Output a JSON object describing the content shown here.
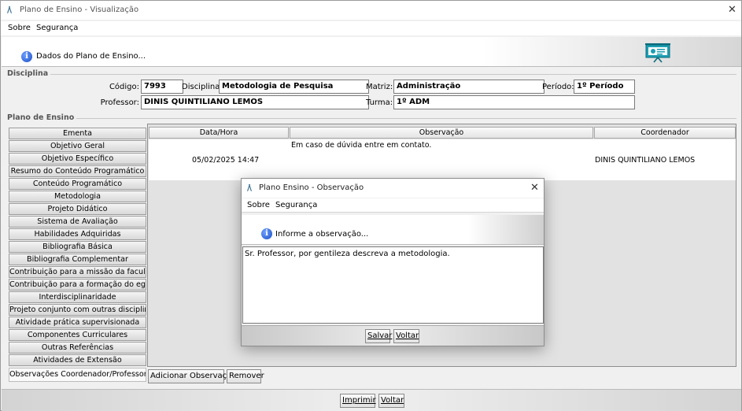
{
  "window": {
    "title": "Plano de Ensino - Visualização",
    "close": "✕",
    "logo": "/\\",
    "menu": [
      "Sobre",
      "Segurança"
    ],
    "banner_text": "Dados do Plano de Ensino...",
    "banner_icon": "info-icon",
    "brand_icon": "presentation-icon"
  },
  "disciplina": {
    "section_label": "Disciplina",
    "codigo_label": "Código:",
    "codigo_value": "7993",
    "disciplina_label": "Disciplina:",
    "disciplina_value": "Metodologia de Pesquisa",
    "matriz_label": "Matriz:",
    "matriz_value": "Administração",
    "periodo_label": "Período:",
    "periodo_value": "1º Período",
    "professor_label": "Professor:",
    "professor_value": "DINIS QUINTILIANO LEMOS",
    "turma_label": "Turma:",
    "turma_value": "1º ADM"
  },
  "plano": {
    "section_label": "Plano de Ensino",
    "items": [
      "Ementa",
      "Objetivo Geral",
      "Objetivo Específico",
      "Resumo do Conteúdo Programático",
      "Conteúdo Programático",
      "Metodologia",
      "Projeto Didático",
      "Sistema de Avaliação",
      "Habilidades Adquiridas",
      "Bibliografia Básica",
      "Bibliografia Complementar",
      "Contribuição para a missão da faculdade",
      "Contribuição para a formação do egresso",
      "Interdisciplinaridade",
      "Projeto conjunto com outras disciplinas",
      "Atividade prática supervisionada",
      "Componentes Curriculares",
      "Outras Referências",
      "Atividades de Extensão",
      "Observações Coordenador/Professor"
    ],
    "active_item": "Observações Coordenador/Professor"
  },
  "table": {
    "columns": [
      "Data/Hora",
      "Observação",
      "Coordenador"
    ],
    "rows": [
      {
        "datahora": "05/02/2025 14:47",
        "observacao": "Em caso de dúvida entre em contato.",
        "coordenador": "DINIS QUINTILIANO LEMOS"
      }
    ]
  },
  "actions": {
    "adicionar": "Adicionar Observação",
    "remover": "Remover",
    "imprimir": "Imprimir",
    "voltar": "Voltar"
  },
  "dialog": {
    "title": "Plano Ensino - Observação",
    "close": "✕",
    "menu": [
      "Sobre",
      "Segurança"
    ],
    "banner_text": "Informe a observação...",
    "text_value": "Sr. Professor, por gentileza descreva a metodologia.",
    "salvar": "Salvar",
    "voltar": "Voltar"
  },
  "colors": {
    "accent": "#3b6f8f",
    "info_blue": "#1b4fc4",
    "field_bg": "#ffffff",
    "window_bg": "#f0f0f0"
  }
}
